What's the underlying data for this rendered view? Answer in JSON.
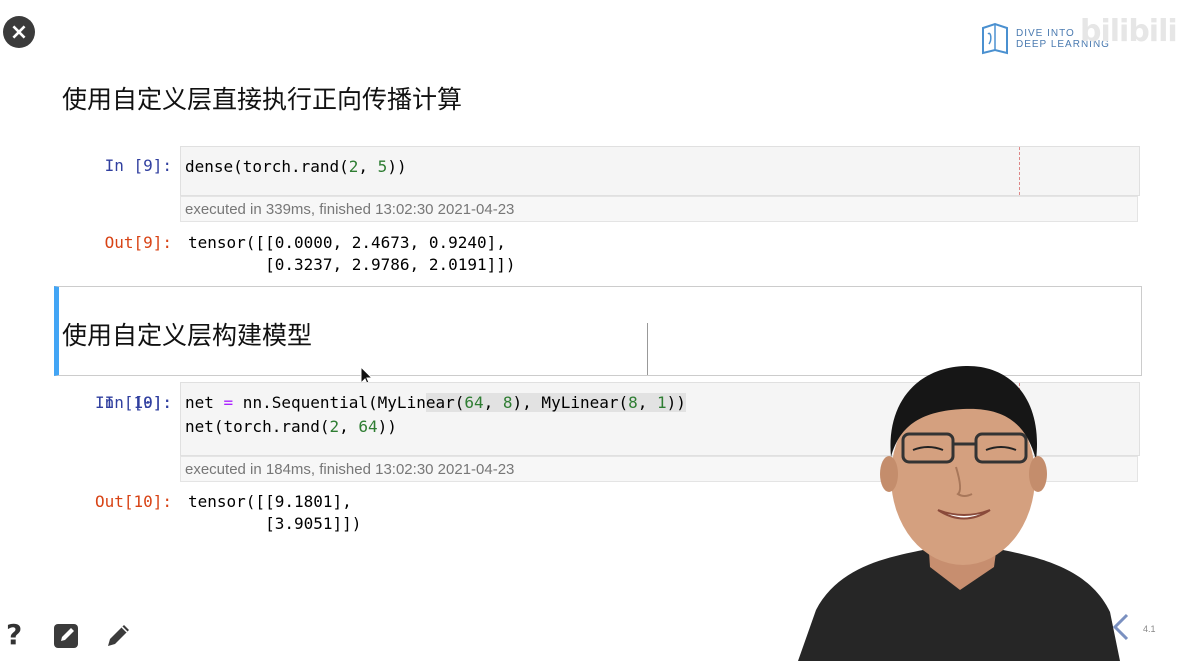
{
  "toolbar": {
    "close_icon": "×",
    "help_icon": "?"
  },
  "branding": {
    "logo_line1": "DIVE INTO",
    "logo_line2": "DEEP LEARNING",
    "watermark": "bilibili"
  },
  "notebook": {
    "heading1": "使用自定义层直接执行正向传播计算",
    "heading2": "使用自定义层构建模型",
    "cells": [
      {
        "in_prompt": "In [9]:",
        "exec_info": "executed in 339ms, finished 13:02:30 2021-04-23",
        "out_prompt": "Out[9]:",
        "output": "tensor([[0.0000, 2.4673, 0.9240],\n        [0.3237, 2.9786, 2.0191]])"
      },
      {
        "in_prompt": "In [10]:",
        "exec_info": "executed in 184ms, finished 13:02:30 2021-04-23",
        "out_prompt": "Out[10]:",
        "output": "tensor([[9.1801],\n        [3.9051]])"
      }
    ]
  },
  "slide": {
    "page_number": "4.1"
  },
  "colors": {
    "in_prompt": "#303f9f",
    "out_prompt": "#d84315",
    "number": "#2e7d32",
    "operator": "#aa22ff",
    "markdown_border": "#42a5f5"
  }
}
